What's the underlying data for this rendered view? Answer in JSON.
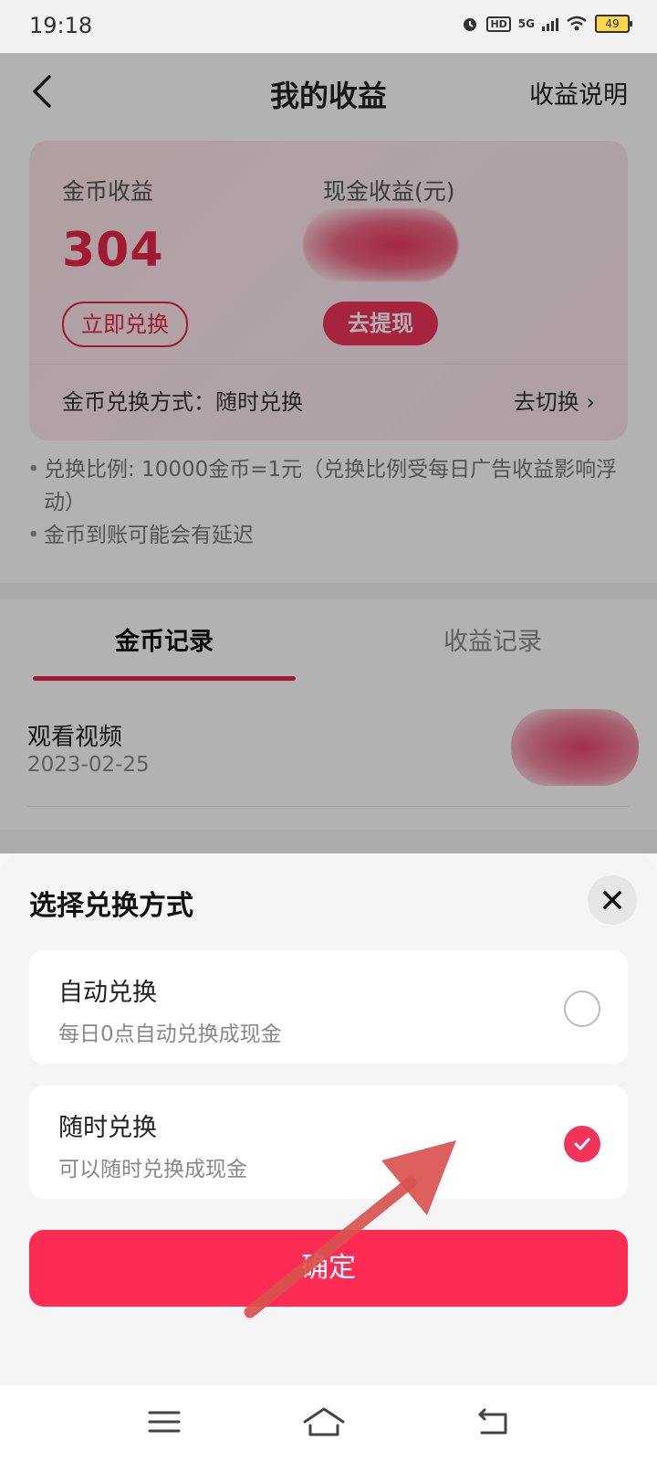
{
  "status_bar": {
    "time": "19:18",
    "network": "5G",
    "hd": "HD",
    "battery": "49"
  },
  "header": {
    "title": "我的收益",
    "right_link": "收益说明",
    "back_icon": "chevron-left-icon"
  },
  "earnings_card": {
    "coin_label": "金币收益",
    "coin_value": "304",
    "cash_label": "现金收益(元)",
    "exchange_button": "立即兑换",
    "withdraw_button": "去提现",
    "method_text": "金币兑换方式：随时兑换",
    "switch_link": "去切换 ›"
  },
  "notes": [
    "兑换比例: 10000金币=1元（兑换比例受每日广告收益影响浮动）",
    "金币到账可能会有延迟"
  ],
  "tabs": {
    "active": "金币记录",
    "inactive": "收益记录"
  },
  "records": [
    {
      "title": "观看视频",
      "date": "2023-02-25"
    }
  ],
  "sheet": {
    "title": "选择兑换方式",
    "options": [
      {
        "title": "自动兑换",
        "subtitle": "每日0点自动兑换成现金",
        "selected": false
      },
      {
        "title": "随时兑换",
        "subtitle": "可以随时兑换成现金",
        "selected": true
      }
    ],
    "confirm_button": "确定"
  },
  "colors": {
    "accent": "#fe2c55",
    "coin_red": "#e8254a",
    "annotation_arrow": "#d9534f"
  },
  "nav_icons": [
    "menu-icon",
    "home-icon",
    "back-icon"
  ]
}
